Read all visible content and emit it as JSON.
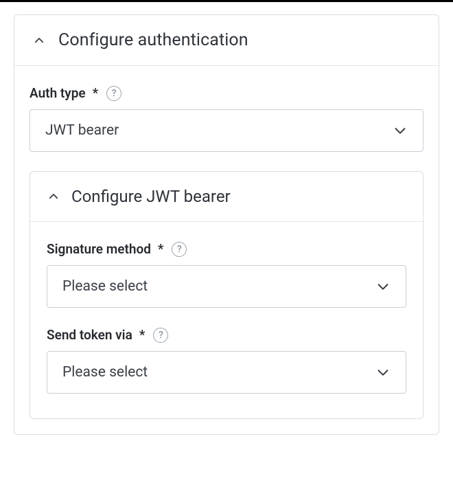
{
  "panel": {
    "title": "Configure authentication",
    "authType": {
      "label": "Auth type",
      "required": "*",
      "value": "JWT bearer"
    },
    "jwtPanel": {
      "title": "Configure JWT bearer",
      "signatureMethod": {
        "label": "Signature method",
        "required": "*",
        "placeholder": "Please select"
      },
      "sendTokenVia": {
        "label": "Send token via",
        "required": "*",
        "placeholder": "Please select"
      }
    }
  },
  "helpGlyph": "?"
}
